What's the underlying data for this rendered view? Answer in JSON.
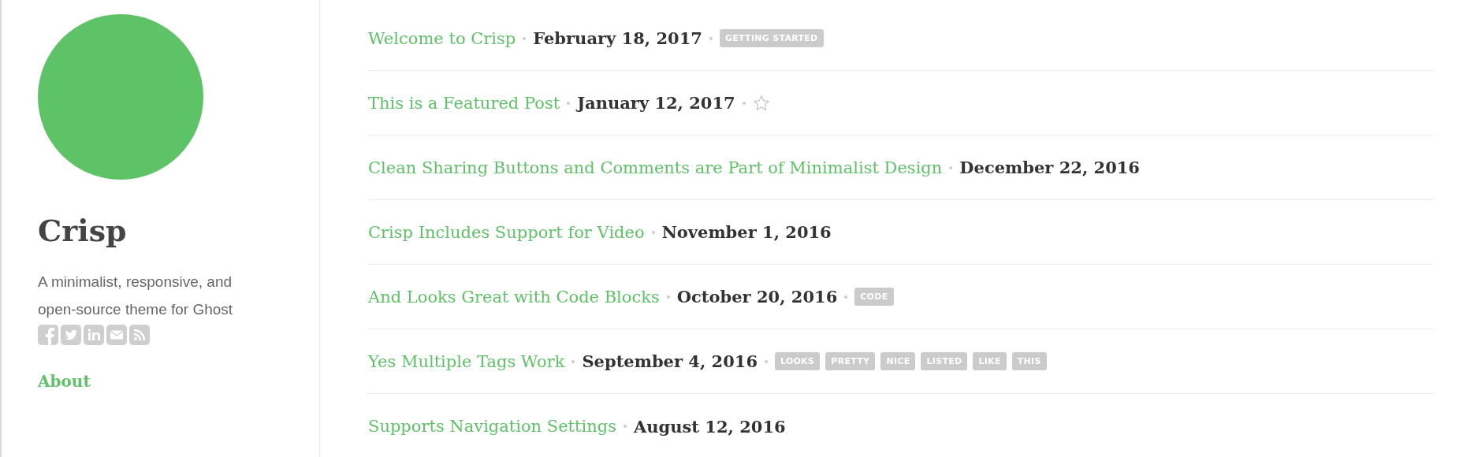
{
  "sidebar": {
    "title": "Crisp",
    "description": "A minimalist, responsive, and open-source theme for Ghost",
    "nav": [
      {
        "label": "About"
      }
    ]
  },
  "posts": [
    {
      "title": "Welcome to Crisp",
      "date": "February 18, 2017",
      "featured": false,
      "tags": [
        "GETTING STARTED"
      ]
    },
    {
      "title": "This is a Featured Post",
      "date": "January 12, 2017",
      "featured": true
    },
    {
      "title": "Clean Sharing Buttons and Comments are Part of Minimalist Design",
      "date": "December 22, 2016",
      "featured": false
    },
    {
      "title": "Crisp Includes Support for Video",
      "date": "November 1, 2016",
      "featured": false
    },
    {
      "title": "And Looks Great with Code Blocks",
      "date": "October 20, 2016",
      "featured": false,
      "tags": [
        "CODE"
      ]
    },
    {
      "title": "Yes Multiple Tags Work",
      "date": "September 4, 2016",
      "featured": false,
      "tags": [
        "LOOKS",
        "PRETTY",
        "NICE",
        "LISTED",
        "LIKE",
        "THIS"
      ]
    },
    {
      "title": "Supports Navigation Settings",
      "date": "August 12, 2016",
      "featured": false
    }
  ]
}
